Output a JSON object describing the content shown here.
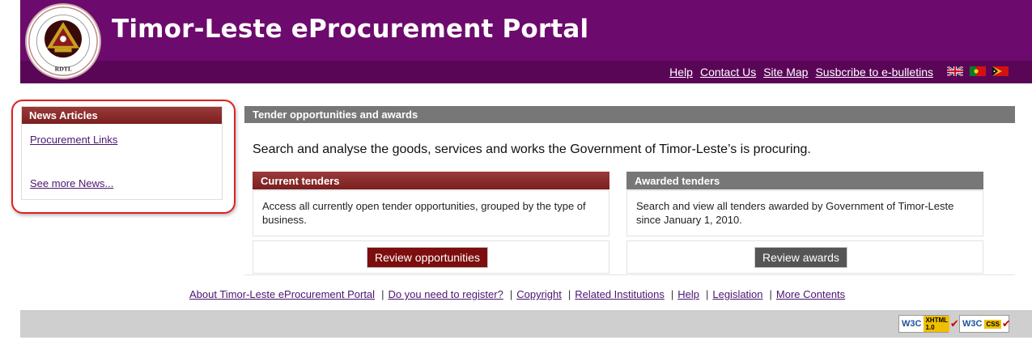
{
  "header": {
    "title": "Timor-Leste eProcurement Portal",
    "nav": [
      "Help",
      "Contact Us",
      "Site Map",
      "Susbcribe to e-bulletins"
    ],
    "flags": [
      "uk-flag-icon",
      "portugal-flag-icon",
      "timor-leste-flag-icon"
    ],
    "seal_text": "REPÚBLICA DEMOCRÁTICA DE TIMOR-LESTE",
    "seal_abbrev": "RDTL"
  },
  "news": {
    "title": "News Articles",
    "links": [
      "Procurement Links",
      "See more News..."
    ]
  },
  "main": {
    "title": "Tender opportunities and awards",
    "description": "Search and analyse the goods, services and works the Government of Timor-Leste’s is procuring.",
    "current": {
      "title": "Current tenders",
      "text": "Access all currently open tender opportunities, grouped by the type of business.",
      "button": "Review opportunities"
    },
    "awarded": {
      "title": "Awarded tenders",
      "text": "Search and view all tenders awarded by Government of Timor-Leste since January 1, 2010.",
      "button": "Review awards"
    }
  },
  "footer": {
    "links": [
      "About Timor-Leste eProcurement Portal",
      "Do you need to register?",
      "Copyright",
      "Related Institutions",
      "Help",
      "Legislation",
      "More Contents"
    ],
    "separator": "|",
    "badges": [
      {
        "logo": "W3C",
        "label": "XHTML 1.0"
      },
      {
        "logo": "W3C",
        "label": "CSS"
      }
    ]
  },
  "colors": {
    "header": "#6d0a6d",
    "header_strip": "#5a0657",
    "panel_red": "#7a1f1f",
    "panel_grey": "#777777",
    "highlight": "#e02020"
  }
}
